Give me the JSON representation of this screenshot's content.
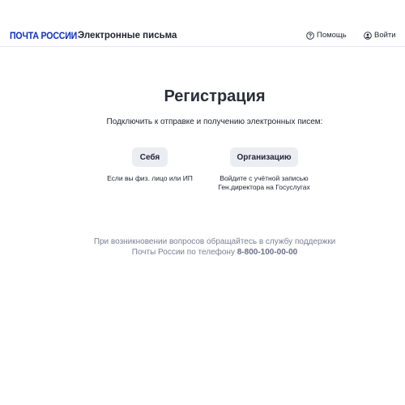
{
  "header": {
    "logo_text": "ПОЧТА РОССИИ",
    "service_title": "Электронные письма",
    "help_label": "Помощь",
    "login_label": "Войти"
  },
  "main": {
    "title": "Регистрация",
    "subtitle": "Подключить к отправке и получению электронных писем:",
    "options": [
      {
        "label": "Себя",
        "caption": "Если вы физ. лицо или ИП"
      },
      {
        "label": "Организацию",
        "caption_line1": "Войдите с учётной записью",
        "caption_line2": "Ген.директора на Госуслугах"
      }
    ]
  },
  "support": {
    "line1": "При возникновении вопросов обращайтесь в службу поддержки",
    "line2_prefix": "Почты России по телефону",
    "phone": "8-800-100-00-00"
  },
  "colors": {
    "brand": "#0d2ec1",
    "button_bg": "#ecedf3",
    "muted_text": "#7b7f93"
  }
}
